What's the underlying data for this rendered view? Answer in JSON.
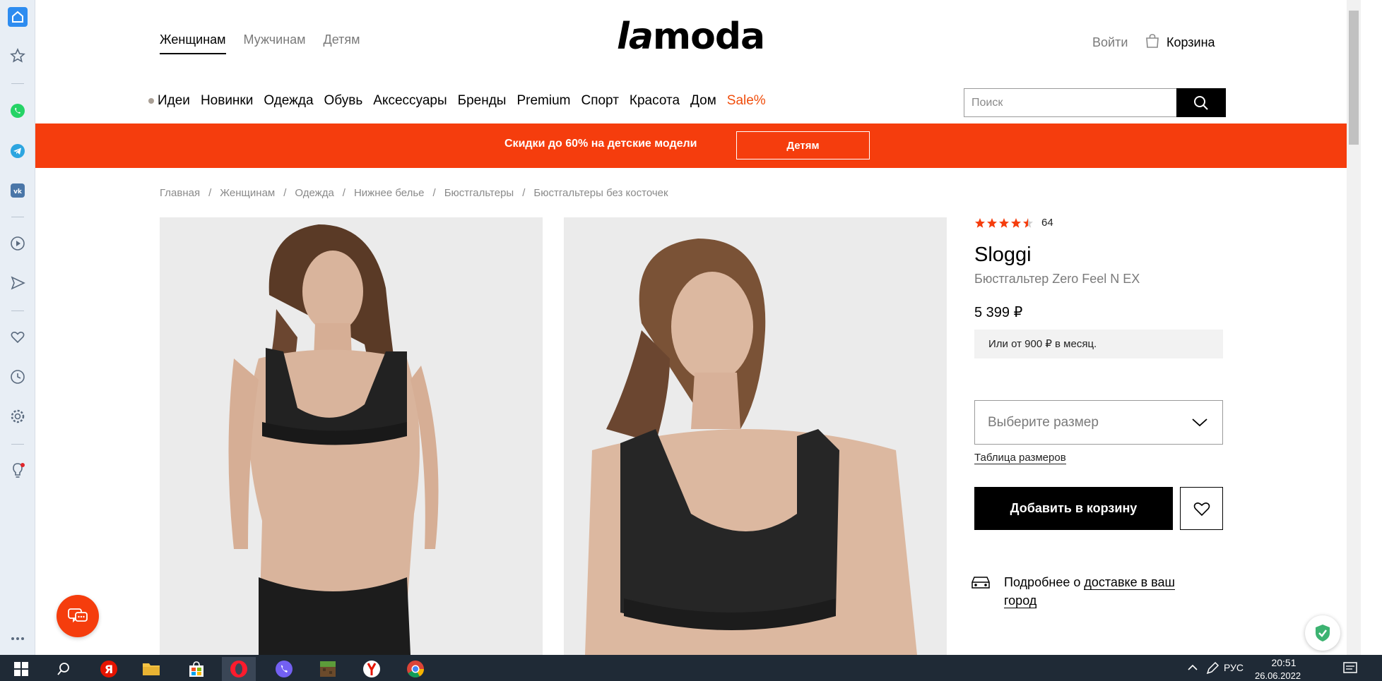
{
  "browser_sidebar": {
    "icons": [
      "home-icon",
      "star-icon",
      "whatsapp-icon",
      "telegram-icon",
      "vk-icon",
      "player-icon",
      "send-icon",
      "heart-icon",
      "clock-icon",
      "settings-icon",
      "lightbulb-icon",
      "more-icon"
    ]
  },
  "header": {
    "gender_tabs": [
      "Женщинам",
      "Мужчинам",
      "Детям"
    ],
    "logo": {
      "la": "la",
      "moda": "moda"
    },
    "login": "Войти",
    "cart": "Корзина",
    "categories": [
      "Идеи",
      "Новинки",
      "Одежда",
      "Обувь",
      "Аксессуары",
      "Бренды",
      "Premium",
      "Спорт",
      "Красота",
      "Дом"
    ],
    "sale": "Sale%",
    "search_placeholder": "Поиск",
    "accent_color": "#f53d0d"
  },
  "promo": {
    "text": "Скидки до 60% на детские модели",
    "button": "Детям"
  },
  "breadcrumbs": [
    "Главная",
    "Женщинам",
    "Одежда",
    "Нижнее белье",
    "Бюстгальтеры",
    "Бюстгальтеры без косточек"
  ],
  "product": {
    "rating_count": "64",
    "rating_stars": 4.5,
    "brand": "Sloggi",
    "name": "Бюстгальтер Zero Feel N EX",
    "price": "5 399 ₽",
    "installment": "Или от 900 ₽ в месяц.",
    "size_placeholder": "Выберите размер",
    "size_table": "Таблица размеров",
    "add_to_cart": "Добавить в корзину",
    "delivery_prefix": "Подробнее о ",
    "delivery_link": "доставке в ваш город"
  },
  "taskbar": {
    "language": "РУС",
    "time": "20:51",
    "date": "26.06.2022"
  }
}
